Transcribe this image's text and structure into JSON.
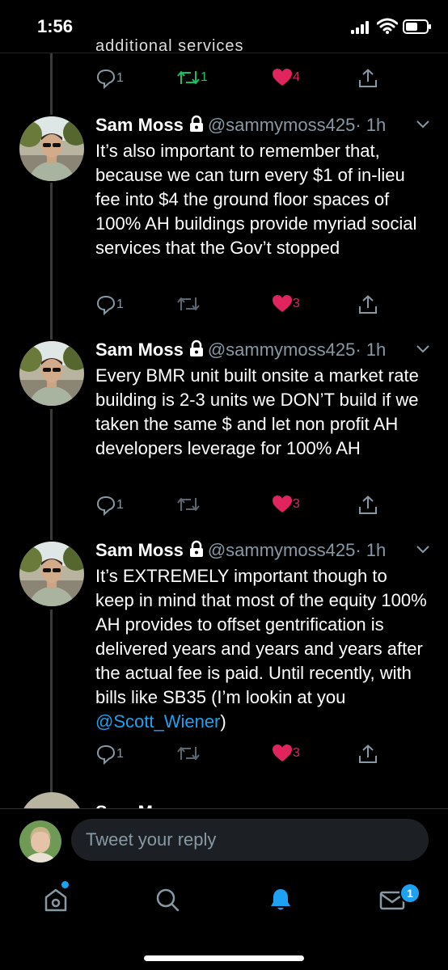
{
  "status_bar": {
    "time": "1:56"
  },
  "clipped_tweet": {
    "visible_text": "additional services",
    "replies": "1",
    "retweets": "1",
    "likes": "4"
  },
  "tweets": [
    {
      "name": "Sam Moss",
      "handle": "@sammymoss425",
      "time": "· 1h",
      "text": "It’s also important to remember that, because we can turn every $1 of in-lieu fee into $4 the ground floor spaces of 100% AH buildings provide myriad social services that the Gov’t stopped",
      "replies": "1",
      "likes": "3"
    },
    {
      "name": "Sam Moss",
      "handle": "@sammymoss425",
      "time": "· 1h",
      "text": "Every BMR unit built onsite a market rate building is 2-3 units we DON’T build if we taken the same $ and let non profit AH developers leverage for 100% AH",
      "replies": "1",
      "likes": "3"
    },
    {
      "name": "Sam Moss",
      "handle": "@sammymoss425",
      "time": "· 1h",
      "text_before_link": "It’s EXTREMELY important though to keep in mind that most of the equity 100% AH provides to offset gentrification is delivered years and years and years after the actual fee is paid. Until recently, with bills like SB35 (I’m lookin at you ",
      "link": "@Scott_Wiener",
      "text_after_link": ")",
      "replies": "1",
      "likes": "3"
    }
  ],
  "next_tweet_partial": {
    "name": "Sam Moss"
  },
  "composer": {
    "placeholder": "Tweet your reply"
  },
  "tabbar": {
    "dm_badge": "1"
  },
  "colors": {
    "accent": "#1da1f2",
    "like": "#e0245e",
    "retweet": "#17bf63",
    "muted": "#8899a6"
  }
}
